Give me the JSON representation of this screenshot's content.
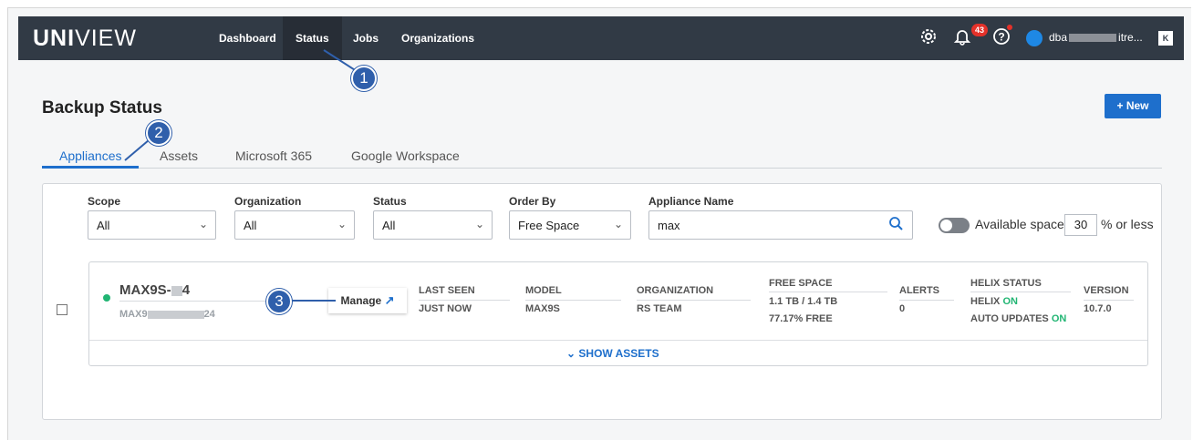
{
  "topbar": {
    "logo_bold": "UNI",
    "logo_thin": "VIEW",
    "nav": [
      "Dashboard",
      "Status",
      "Jobs",
      "Organizations"
    ],
    "active_nav": "Status",
    "notification_count": "43",
    "user_prefix": "dba",
    "user_suffix": "itre...",
    "kb_label": "K"
  },
  "page": {
    "title": "Backup Status",
    "new_button": "+ New"
  },
  "tabs": [
    "Appliances",
    "Assets",
    "Microsoft 365",
    "Google Workspace"
  ],
  "active_tab": "Appliances",
  "filters": {
    "scope": {
      "label": "Scope",
      "value": "All"
    },
    "organization": {
      "label": "Organization",
      "value": "All"
    },
    "status": {
      "label": "Status",
      "value": "All"
    },
    "order_by": {
      "label": "Order By",
      "value": "Free Space"
    },
    "appliance_name": {
      "label": "Appliance Name",
      "value": "max"
    },
    "available_space_label": "Available space",
    "available_space_value": "30",
    "available_space_suffix": "% or less"
  },
  "appliance": {
    "name_prefix": "MAX9S-",
    "name_suffix": "4",
    "sub_prefix": "MAX9",
    "sub_suffix": "24",
    "manage_label": "Manage",
    "last_seen_h": "LAST SEEN",
    "last_seen_v": "JUST NOW",
    "model_h": "MODEL",
    "model_v": "MAX9S",
    "org_h": "ORGANIZATION",
    "org_v": "RS TEAM",
    "free_space_h": "FREE SPACE",
    "free_space_v1": "1.1 TB / 1.4 TB",
    "free_space_v2": "77.17% FREE",
    "alerts_h": "ALERTS",
    "alerts_v": "0",
    "helix_h": "HELIX STATUS",
    "helix_label": "HELIX",
    "helix_on": "ON",
    "auto_label": "AUTO UPDATES",
    "auto_on": "ON",
    "version_h": "VERSION",
    "version_v": "10.7.0",
    "show_assets": "SHOW ASSETS"
  },
  "callouts": [
    "1",
    "2",
    "3"
  ],
  "colors": {
    "accent": "#1e6fcc",
    "topbar": "#313a45",
    "online": "#21b573",
    "callout": "#2f5fab"
  }
}
